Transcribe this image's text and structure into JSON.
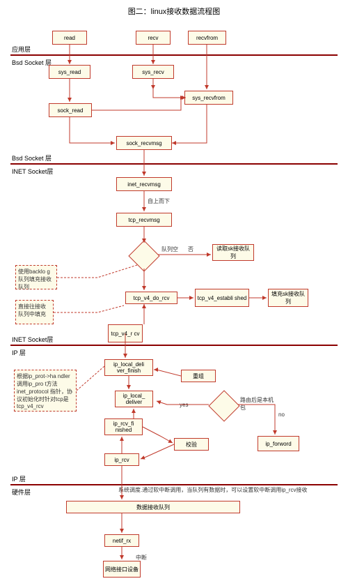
{
  "title": "图二：linux接收数据流程图",
  "layers": {
    "app": "应用层",
    "bsd1": "Bsd Socket 层",
    "bsd2": "Bsd Socket 层",
    "inet1": "INET Socket层",
    "inet2": "INET Socket层",
    "ip1": "IP 层",
    "ip2": "IP 层",
    "hw": "硬件层"
  },
  "nodes": {
    "read": "read",
    "recv": "recv",
    "recvfrom": "recvfrom",
    "sys_read": "sys_read",
    "sys_recv": "sys_recv",
    "sys_recvfrom": "sys_recvfrom",
    "sock_read": "sock_read",
    "sock_recvmsg": "sock_recvmsg",
    "inet_recvmsg": "inet_recvmsg",
    "tcp_recvmsg": "tcp_recvmsg",
    "read_sk_queue": "读取sk接收队列",
    "tcp_v4_do_rcv": "tcp_v4_do_rcv",
    "tcp_v4_established": "tcp_v4_establi shed",
    "fill_sk_queue": "填充sk接收队列",
    "tcp_v4_rcv": "tcp_v4_r cv",
    "ip_local_deliver_finish": "ip_local_deli ver_finish",
    "ip_local_deliver": "ip_local_ deliver",
    "ip_rcv_finished": "ip_rcv_fi nished",
    "ip_rcv": "ip_rcv",
    "ip_forword": "ip_forword",
    "data_recv_queue": "数据接收队列",
    "netif_rx": "netif_rx",
    "nic": "网络接口设备"
  },
  "notes": {
    "note1": "使用backlo g队列填充接收队列",
    "note2": "直接往接收队列中填充",
    "note3": "根据ip_prot->ha ndler调用ip_pro t方法inet_protocol 指针，协议初始化时针对tcp是 tcp_v4_rcv"
  },
  "labels": {
    "top_down": "自上而下",
    "queue_empty": "队列空",
    "no": "否",
    "reassemble": "重组",
    "checksum": "校验",
    "route_local": "路由后是本机包",
    "yes": "yes",
    "no2": "no",
    "interrupt": "中断",
    "softirq": "系统调度.通过软中断调用，当队列有数据时，可以设置软中断调用ip_rcv接收"
  }
}
